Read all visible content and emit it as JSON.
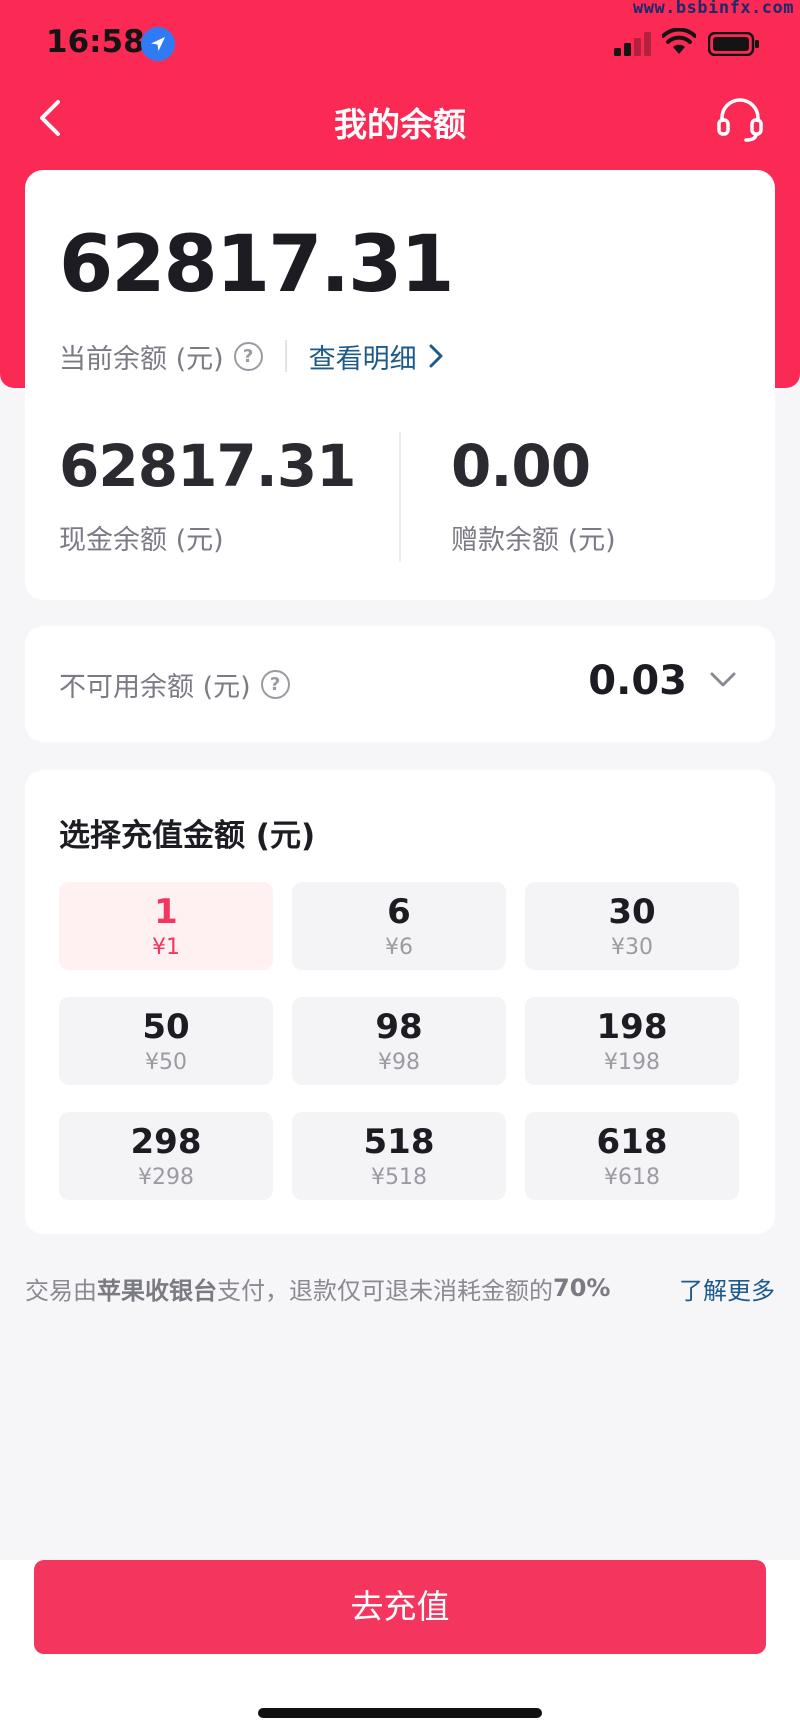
{
  "watermark": "www.bsbinfx.com",
  "status_bar": {
    "time": "16:58"
  },
  "nav": {
    "title": "我的余额"
  },
  "balance": {
    "current_value": "62817.31",
    "current_label": "当前余额 (元)",
    "detail_link": "查看明细",
    "cash_value": "62817.31",
    "cash_label": "现金余额 (元)",
    "bonus_value": "0.00",
    "bonus_label": "赠款余额 (元)"
  },
  "unavailable": {
    "label": "不可用余额 (元)",
    "value": "0.03"
  },
  "recharge": {
    "title": "选择充值金额 (元)",
    "options": [
      {
        "amount": "1",
        "price": "¥1",
        "selected": true
      },
      {
        "amount": "6",
        "price": "¥6",
        "selected": false
      },
      {
        "amount": "30",
        "price": "¥30",
        "selected": false
      },
      {
        "amount": "50",
        "price": "¥50",
        "selected": false
      },
      {
        "amount": "98",
        "price": "¥98",
        "selected": false
      },
      {
        "amount": "198",
        "price": "¥198",
        "selected": false
      },
      {
        "amount": "298",
        "price": "¥298",
        "selected": false
      },
      {
        "amount": "518",
        "price": "¥518",
        "selected": false
      },
      {
        "amount": "618",
        "price": "¥618",
        "selected": false
      }
    ]
  },
  "notice": {
    "part1": "交易由",
    "bold": "苹果收银台",
    "part2": "支付，退款仅可退未消耗金额的",
    "percent": "70%",
    "learn_more": "了解更多"
  },
  "cta": {
    "label": "去充值"
  },
  "colors": {
    "brand": "#fb2a55",
    "cta": "#f4355e",
    "link": "#1d5a8c",
    "selected_text": "#f2365f"
  }
}
